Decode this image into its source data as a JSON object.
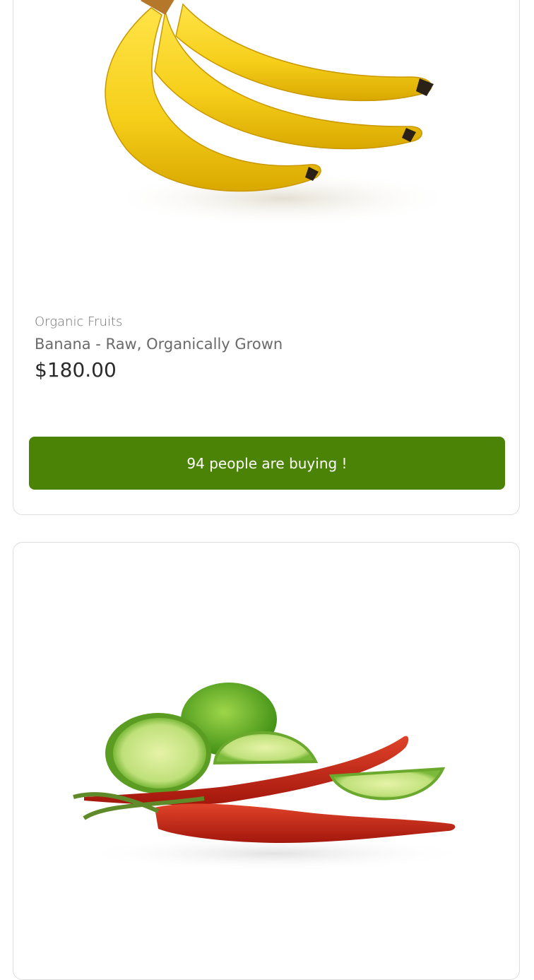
{
  "products": [
    {
      "image_icon": "banana-image",
      "category": "Organic Fruits",
      "title": "Banana - Raw, Organically Grown",
      "price": "$180.00",
      "buying_label": "94 people are buying !"
    },
    {
      "image_icon": "lime-chili-image"
    }
  ],
  "colors": {
    "button_bg": "#4b8306",
    "card_border": "#dcdcdc"
  }
}
